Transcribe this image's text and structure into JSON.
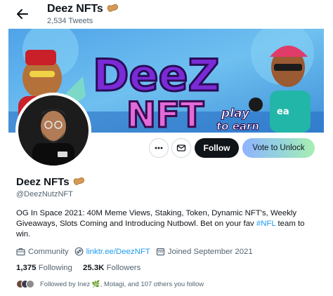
{
  "header": {
    "title": "Deez NFTs",
    "tweet_count": "2,534 Tweets",
    "back_icon": "arrow-left-icon",
    "emoji_icon": "peanut-icon"
  },
  "actions": {
    "more_icon": "more-dots-icon",
    "message_icon": "envelope-icon",
    "follow_label": "Follow",
    "vote_label": "Vote to Unlock"
  },
  "profile": {
    "name": "Deez NFTs",
    "handle": "@DeezNutzNFT",
    "bio_text": "OG In Space 2021:  40M Meme Views, Staking, Token, Dynamic NFT's, Weekly Giveaways, Slots Coming and Introducing Nutbowl.  Bet on your fav ",
    "bio_hashtag": "#NFL",
    "bio_end": " team to win.",
    "category": "Community",
    "website": "linktr.ee/DeezNFT",
    "joined": "Joined September 2021"
  },
  "stats": {
    "following_count": "1,375",
    "following_label": "Following",
    "followers_count": "25.3K",
    "followers_label": "Followers"
  },
  "followed_by": "Followed by Inez 🌿, Motagi, and 107 others you follow",
  "colors": {
    "accent": "#1d9bf0",
    "text_secondary": "#536471",
    "follow_bg": "#0f1419"
  }
}
